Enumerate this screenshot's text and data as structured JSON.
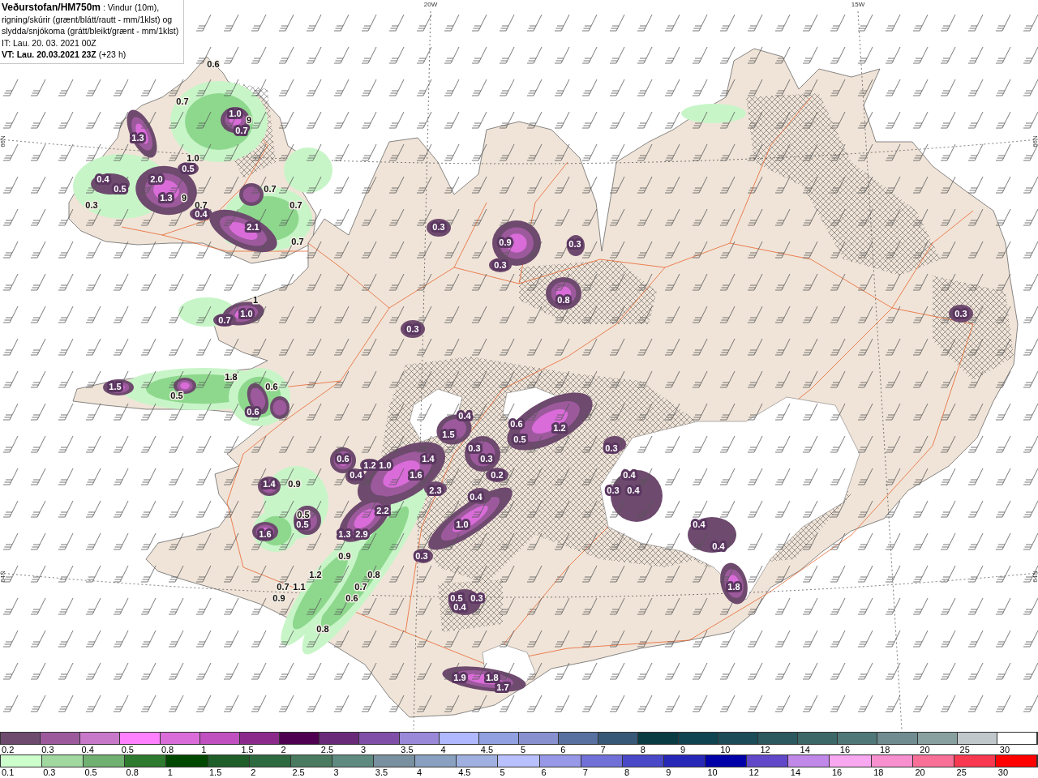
{
  "header": {
    "lines": [
      "**Veðurstofan/HM750m** : Vindur (10m),",
      "rigning/skúrir (grænt/blátt/rautt - mm/1klst) og",
      "slydda/snjókoma (grátt/bleikt/grænt - mm/1klst)"
    ],
    "issue_time": "IT: Lau. 20. 03. 2021 00Z",
    "valid_time": "**VT: Lau. 20.03.2021 23Z** (+23 h)"
  },
  "map": {
    "longitude_labels": [
      "20W",
      "15W"
    ],
    "latitude_labels_left": [
      "66N",
      "64N"
    ],
    "latitude_labels_right": [
      "66N",
      "64N"
    ],
    "values": [
      "0.6",
      "0.7",
      "1.0",
      "9",
      "0.7",
      "1.3",
      "1.0",
      "0.5",
      "0.4",
      "2.0",
      "0.5",
      "0.7",
      "1.3",
      "9",
      "0.3",
      "0.7",
      "0.7",
      "0.4",
      "2.1",
      "0.3",
      "0.7",
      "0.9",
      "0.3",
      "0.3",
      "1",
      "0.8",
      "1.0",
      "0.3",
      "0.7",
      "0.3",
      "1.8",
      "1.5",
      "0.6",
      "0.5",
      "0.6",
      "0.4",
      "0.6",
      "1.2",
      "1.5",
      "0.5",
      "0.3",
      "0.3",
      "0.6",
      "1.4",
      "0.3",
      "1.2",
      "1.0",
      "0.4",
      "1.6",
      "0.2",
      "0.4",
      "1.4",
      "0.9",
      "2.3",
      "0.3",
      "0.4",
      "0.4",
      "2.2",
      "0.5",
      "0.5",
      "1.0",
      "0.4",
      "1.6",
      "1.3",
      "2.9",
      "0.4",
      "0.9",
      "0.3",
      "1.2",
      "0.8",
      "0.7",
      "1.1",
      "0.7",
      "1.8",
      "0.9",
      "0.6",
      "0.5",
      "0.3",
      "0.4",
      "0.8",
      "1.9",
      "1.8",
      "1.7"
    ]
  },
  "legends": [
    {
      "entries": [
        {
          "label": "0.2",
          "color": "#6e4a6e"
        },
        {
          "label": "0.3",
          "color": "#9c5a9c"
        },
        {
          "label": "0.4",
          "color": "#c878c8"
        },
        {
          "label": "0.5",
          "color": "#ff80ff"
        },
        {
          "label": "0.8",
          "color": "#d96cd9"
        },
        {
          "label": "1",
          "color": "#c050c0"
        },
        {
          "label": "1.5",
          "color": "#8c2a8c"
        },
        {
          "label": "2",
          "color": "#500050"
        },
        {
          "label": "2.5",
          "color": "#6a2a7a"
        },
        {
          "label": "3",
          "color": "#8050a8"
        },
        {
          "label": "3.5",
          "color": "#9a88d8"
        },
        {
          "label": "4",
          "color": "#b0b8ff"
        },
        {
          "label": "4.5",
          "color": "#90a0e0"
        },
        {
          "label": "5",
          "color": "#8890d0"
        },
        {
          "label": "6",
          "color": "#5870a0"
        },
        {
          "label": "7",
          "color": "#385878"
        },
        {
          "label": "8",
          "color": "#0a3c44"
        },
        {
          "label": "9",
          "color": "#104450"
        },
        {
          "label": "10",
          "color": "#1c4c58"
        },
        {
          "label": "12",
          "color": "#2c5860"
        },
        {
          "label": "14",
          "color": "#3c6868"
        },
        {
          "label": "16",
          "color": "#507878"
        },
        {
          "label": "18",
          "color": "#708c90"
        },
        {
          "label": "20",
          "color": "#88a0a0"
        },
        {
          "label": "25",
          "color": "#c0c8cc"
        },
        {
          "label": "30",
          "color": "#ffffff"
        }
      ]
    },
    {
      "entries": [
        {
          "label": "0.1",
          "color": "#ccffcc"
        },
        {
          "label": "0.3",
          "color": "#a0d8a0"
        },
        {
          "label": "0.5",
          "color": "#70b070"
        },
        {
          "label": "0.8",
          "color": "#2e7a2e"
        },
        {
          "label": "1",
          "color": "#004800"
        },
        {
          "label": "1.5",
          "color": "#1e5e28"
        },
        {
          "label": "2",
          "color": "#2e6a40"
        },
        {
          "label": "2.5",
          "color": "#4a7a60"
        },
        {
          "label": "3",
          "color": "#5e8a80"
        },
        {
          "label": "3.5",
          "color": "#7890a0"
        },
        {
          "label": "4",
          "color": "#8aa0c0"
        },
        {
          "label": "4.5",
          "color": "#a0b0e0"
        },
        {
          "label": "5",
          "color": "#b8c0ff"
        },
        {
          "label": "6",
          "color": "#9898e8"
        },
        {
          "label": "7",
          "color": "#7070d8"
        },
        {
          "label": "8",
          "color": "#4848c8"
        },
        {
          "label": "9",
          "color": "#2828b8"
        },
        {
          "label": "10",
          "color": "#0000a8"
        },
        {
          "label": "12",
          "color": "#6048c8"
        },
        {
          "label": "14",
          "color": "#c088e8"
        },
        {
          "label": "16",
          "color": "#f8a8f0"
        },
        {
          "label": "18",
          "color": "#f890d0"
        },
        {
          "label": "20",
          "color": "#f87098"
        },
        {
          "label": "25",
          "color": "#f83850"
        },
        {
          "label": "30",
          "color": "#ff0000"
        }
      ]
    }
  ]
}
